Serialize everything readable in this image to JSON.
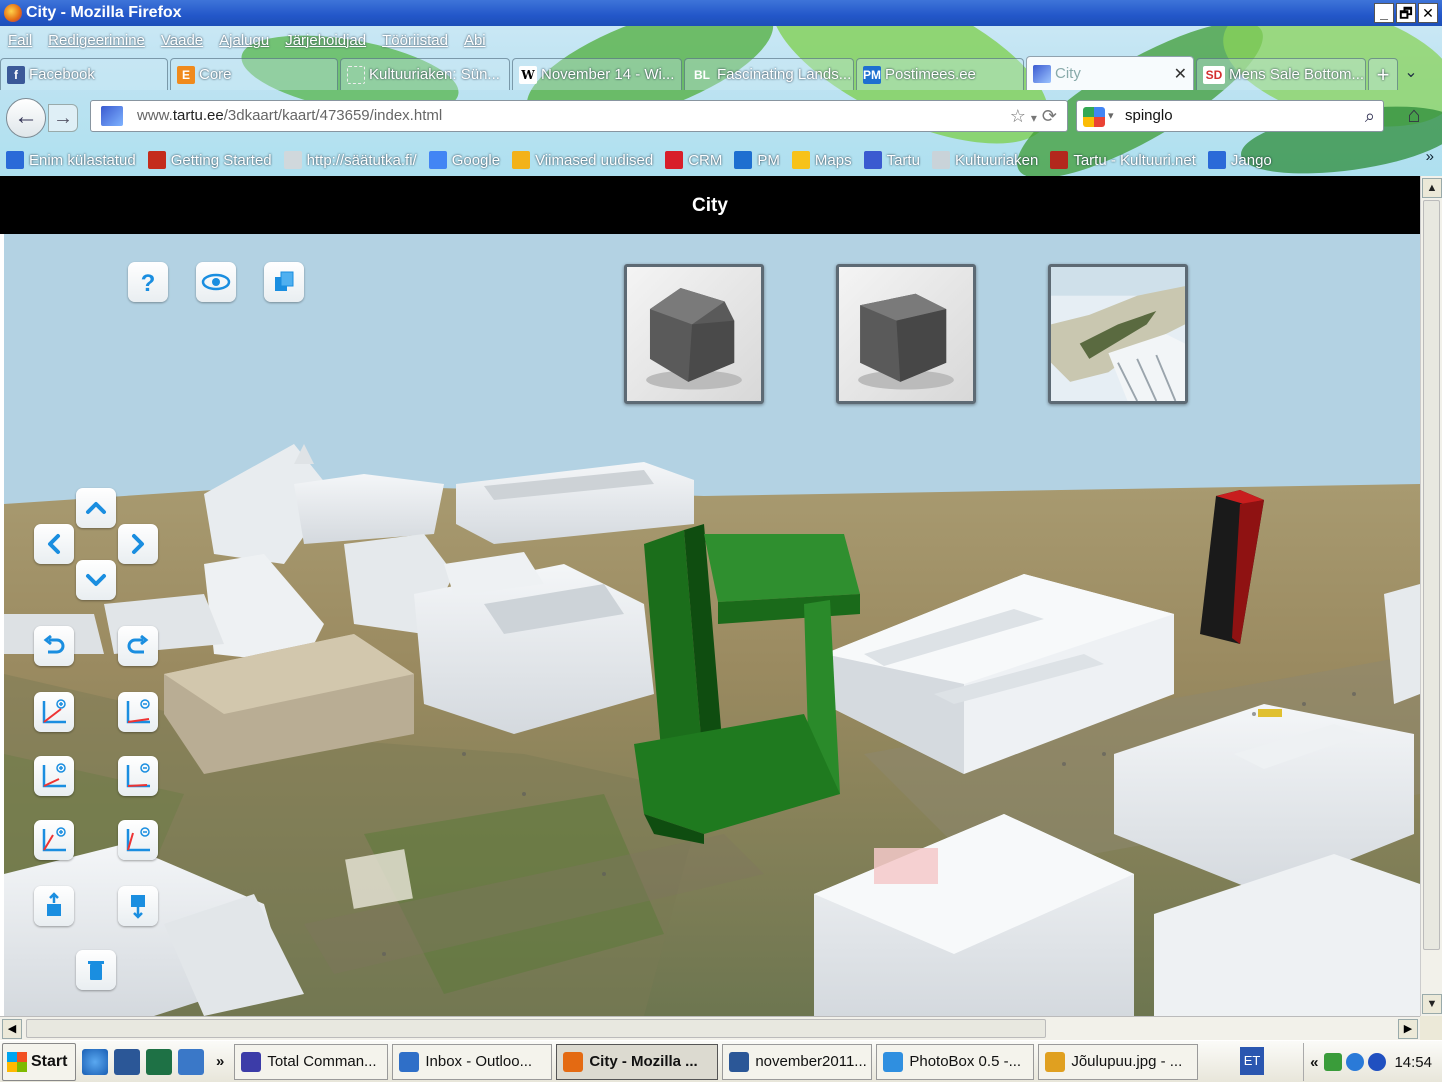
{
  "window": {
    "title": "City - Mozilla Firefox",
    "controls": [
      "_",
      "🗗",
      "✕"
    ]
  },
  "menu": [
    "Fail",
    "Redigeerimine",
    "Vaade",
    "Ajalugu",
    "Järjehoidjad",
    "Tööriistad",
    "Abi"
  ],
  "tabs": [
    {
      "label": "Facebook",
      "icon": "facebook-icon",
      "color": "#3b5998"
    },
    {
      "label": "Core",
      "icon": "core-icon",
      "color": "#f08a1c"
    },
    {
      "label": "Kultuuriaken: Sün...",
      "icon": "page-icon",
      "color": "#c9d3d9"
    },
    {
      "label": "November 14 - Wi...",
      "icon": "wikipedia-icon",
      "color": "#ffffff"
    },
    {
      "label": "Fascinating Lands...",
      "icon": "bl-icon",
      "color": "#2e7d32"
    },
    {
      "label": "Postimees.ee",
      "icon": "pm-icon",
      "color": "#1e6fd0"
    },
    {
      "label": "City",
      "icon": "city-icon",
      "color": "#3a5ad0",
      "active": true
    },
    {
      "label": "Mens Sale Bottom...",
      "icon": "sd-icon",
      "color": "#d32f2f"
    }
  ],
  "new_tab": "+",
  "tab_list": "⌄",
  "nav": {
    "url_domain": "tartu.ee",
    "url_prefix": "www.",
    "url_path": "/3dkaart/kaart/473659/index.html",
    "search_value": "spinglo",
    "search_engine": "Google"
  },
  "bookmarks": [
    {
      "label": "Enim külastatud",
      "color": "#2a6ad8"
    },
    {
      "label": "Getting Started",
      "color": "#c42c1c"
    },
    {
      "label": "http://säätutka.fi/",
      "color": "#d0d8dc"
    },
    {
      "label": "Google",
      "color": "#4285f4"
    },
    {
      "label": "Viimased uudised",
      "color": "#f3b21a"
    },
    {
      "label": "CRM",
      "color": "#d81e2a"
    },
    {
      "label": "PM",
      "color": "#1e6fd0"
    },
    {
      "label": "Maps",
      "color": "#f7c21a"
    },
    {
      "label": "Tartu",
      "color": "#3a5ad0"
    },
    {
      "label": "Kultuuriaken",
      "color": "#c9d3d9"
    },
    {
      "label": "Tartu - Kultuuri.net",
      "color": "#b3281d"
    },
    {
      "label": "Jango",
      "color": "#2a6ad8"
    }
  ],
  "bookmarks_more": "»",
  "page": {
    "title": "City"
  },
  "viewer": {
    "top_tools": [
      "help-icon",
      "eye-icon",
      "cube-icon"
    ],
    "nav_tools": [
      "arrow-up-icon",
      "arrow-left-icon",
      "arrow-right-icon",
      "arrow-down-icon",
      "undo-icon",
      "redo-icon",
      "axis-zoom-in-icon",
      "axis-zoom-out-icon",
      "axis-rotate-in-icon",
      "axis-rotate-out-icon",
      "axis-tilt-in-icon",
      "axis-tilt-out-icon",
      "raise-icon",
      "lower-icon",
      "delete-icon"
    ],
    "thumbnails": [
      "house-model",
      "box-model",
      "aerial-photo"
    ]
  },
  "taskbar": {
    "start": "Start",
    "chevron": "»",
    "items": [
      {
        "label": "Total Comman...",
        "color": "#3c3ca8"
      },
      {
        "label": "Inbox - Outloo...",
        "color": "#2f6fc8"
      },
      {
        "label": "City - Mozilla ...",
        "color": "#e46a12",
        "active": true
      },
      {
        "label": "november2011...",
        "color": "#2b5797"
      },
      {
        "label": "PhotoBox 0.5 -...",
        "color": "#2f8fe0"
      },
      {
        "label": "Jõulupuu.jpg - ...",
        "color": "#e0a020"
      }
    ],
    "language": "ET",
    "tray_chevron": "«",
    "clock": "14:54"
  },
  "colors": {
    "titlebar": "#2357c9",
    "page_header": "#000000",
    "sky": "#b3d2e3",
    "green_building": "#1f7a1f",
    "red_building": "#b01818"
  }
}
